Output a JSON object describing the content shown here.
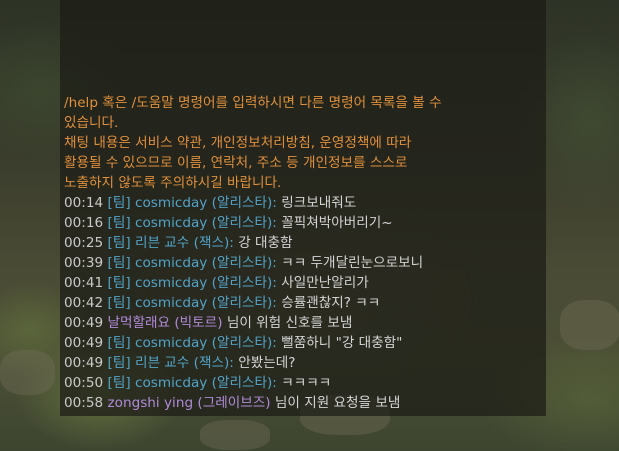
{
  "system_messages": [
    "/help 혹은 /도움말 명령어를 입력하시면 다른 명령어 목록을 볼 수",
    "있습니다.",
    "채팅 내용은 서비스 약관, 개인정보처리방침, 운영정책에 따라",
    "활용될 수 있으므로 이름, 연락처, 주소 등 개인정보를 스스로",
    "노출하지 않도록 주의하시길 바랍니다."
  ],
  "messages": [
    {
      "time": "00:14",
      "channel": "[팀]",
      "sender": "cosmicday (알리스타)",
      "separator": ":",
      "text": "링크보내줘도"
    },
    {
      "time": "00:16",
      "channel": "[팀]",
      "sender": "cosmicday (알리스타)",
      "separator": ":",
      "text": "꼴픽쳐박아버리기~"
    },
    {
      "time": "00:25",
      "channel": "[팀]",
      "sender": "리븐 교수 (잭스)",
      "separator": ":",
      "text": "강 대충함"
    },
    {
      "time": "00:39",
      "channel": "[팀]",
      "sender": "cosmicday (알리스타)",
      "separator": ":",
      "text": "ㅋㅋ 두개달린눈으로보니"
    },
    {
      "time": "00:41",
      "channel": "[팀]",
      "sender": "cosmicday (알리스타)",
      "separator": ":",
      "text": "사일만난알리가"
    },
    {
      "time": "00:42",
      "channel": "[팀]",
      "sender": "cosmicday (알리스타)",
      "separator": ":",
      "text": "승률괜찮지? ㅋㅋ"
    },
    {
      "time": "00:49",
      "channel": "",
      "sender": "날먹할래요 (빅토르)",
      "separator": "",
      "text": "님이 위험 신호를 보냄"
    },
    {
      "time": "00:49",
      "channel": "[팀]",
      "sender": "cosmicday (알리스타)",
      "separator": ":",
      "text": "뻘쭘하니 \"강 대충함\""
    },
    {
      "time": "00:49",
      "channel": "[팀]",
      "sender": "리븐 교수 (잭스)",
      "separator": ":",
      "text": "안봤는데?"
    },
    {
      "time": "00:50",
      "channel": "[팀]",
      "sender": "cosmicday (알리스타)",
      "separator": ":",
      "text": "ㅋㅋㅋㅋ"
    },
    {
      "time": "00:58",
      "channel": "",
      "sender": "zongshi ying (그레이브즈)",
      "separator": "",
      "text": "님이 지원 요청을 보냄"
    }
  ],
  "colors": {
    "system": "#e0903c",
    "team_sender": "#52a4c9",
    "ping_sender": "#b18ad9",
    "text": "#d4d4d4"
  }
}
